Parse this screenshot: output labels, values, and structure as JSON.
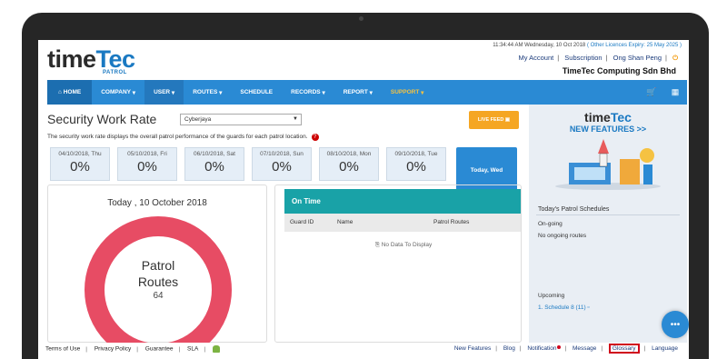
{
  "header": {
    "logo_time": "time",
    "logo_tec": "Tec",
    "logo_sub": "PATROL",
    "datetime": "11:34:44 AM Wednesday, 10 Oct 2018",
    "licence": "( Other Licences Expiry: 25 May 2025 )",
    "links": {
      "my_account": "My Account",
      "subscription": "Subscription",
      "user": "Ong Shan Peng"
    },
    "company": "TimeTec Computing Sdn Bhd"
  },
  "nav": {
    "home": "HOME",
    "company": "COMPANY",
    "user": "USER",
    "routes": "ROUTES",
    "schedule": "SCHEDULE",
    "records": "RECORDS",
    "report": "REPORT",
    "support": "SUPPORT"
  },
  "main": {
    "title": "Security Work Rate",
    "location": "Cyberjaya",
    "live_feed": "LIVE FEED",
    "description": "The security work rate displays the overall patrol performance of the guards for each patrol location.",
    "days": [
      {
        "date": "04/10/2018, Thu",
        "pct": "0%"
      },
      {
        "date": "05/10/2018, Fri",
        "pct": "0%"
      },
      {
        "date": "06/10/2018, Sat",
        "pct": "0%"
      },
      {
        "date": "07/10/2018, Sun",
        "pct": "0%"
      },
      {
        "date": "08/10/2018, Mon",
        "pct": "0%"
      },
      {
        "date": "09/10/2018, Tue",
        "pct": "0%"
      }
    ],
    "today_button": "Today, Wed",
    "today_label": "Today , 10 October 2018",
    "ring_line1": "Patrol",
    "ring_line2": "Routes",
    "ring_count": "64",
    "ontime": {
      "title": "On Time",
      "col_guard": "Guard ID",
      "col_name": "Name",
      "col_routes": "Patrol Routes",
      "empty": "No Data To Display"
    }
  },
  "sidebar": {
    "nf_time": "time",
    "nf_tec": "Tec",
    "nf_title": "NEW FEATURES >>",
    "schedules_title": "Today's Patrol Schedules",
    "ongoing": "On-going",
    "no_routes": "No ongoing routes",
    "upcoming": "Upcoming",
    "upcoming_item": "1. Schedule 8 (11)"
  },
  "footer": {
    "left": [
      "Terms of Use",
      "Privacy Policy",
      "Guarantee",
      "SLA"
    ],
    "new_features": "New Features",
    "blog": "Blog",
    "notification": "Notification",
    "message": "Message",
    "glossary": "Glossary",
    "language": "Language"
  },
  "colors": {
    "nav": "#2a8ad4",
    "ring": "#e74c64",
    "ontime": "#19a2a7",
    "live_feed": "#f5a623"
  }
}
